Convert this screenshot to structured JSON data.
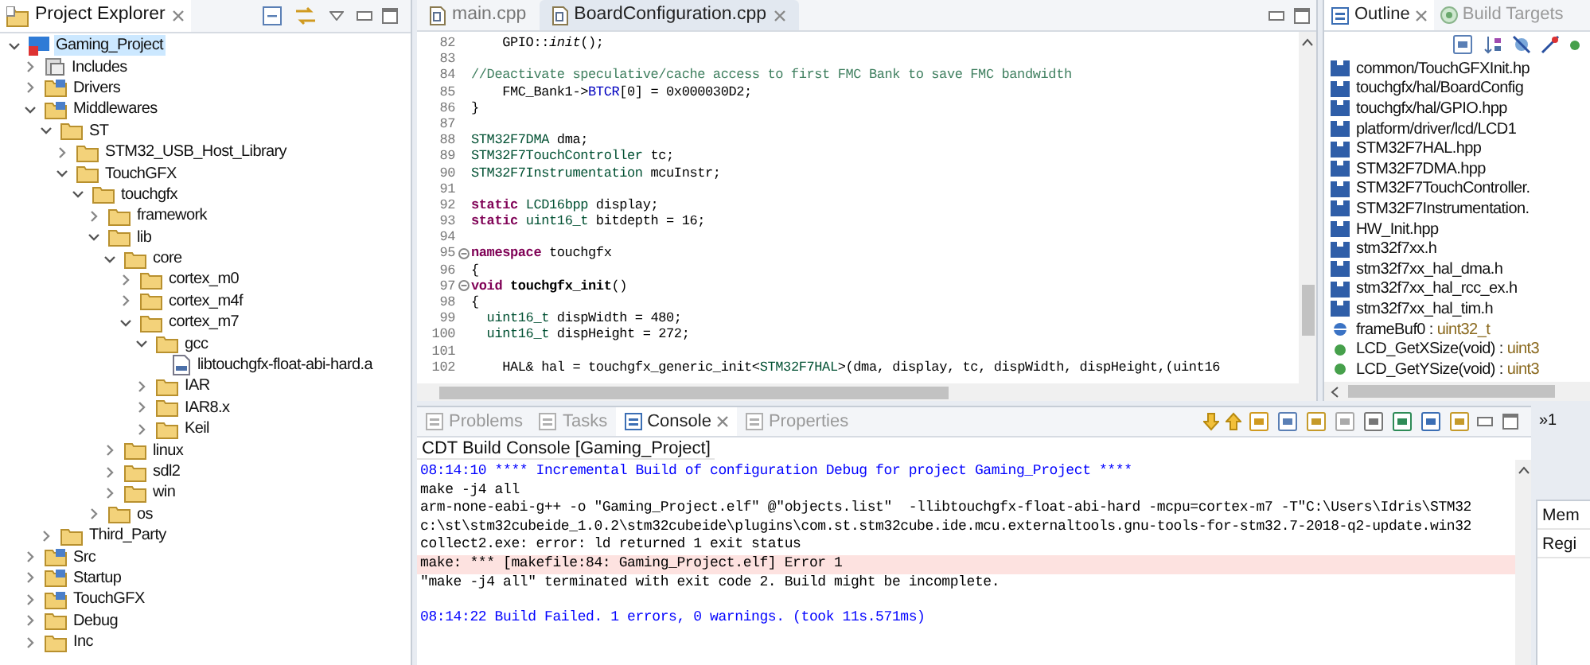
{
  "project_explorer": {
    "tab": {
      "label": "Project Explorer",
      "selected": true
    },
    "tree": [
      {
        "label": "Gaming_Project",
        "kind": "project",
        "expanded": true,
        "selected": true,
        "children": [
          {
            "label": "Includes",
            "kind": "includes",
            "expanded": false,
            "selected": false
          },
          {
            "label": "Drivers",
            "kind": "source_folder",
            "expanded": false,
            "selected": false
          },
          {
            "label": "Middlewares",
            "kind": "source_folder",
            "expanded": true,
            "selected": false,
            "children": [
              {
                "label": "ST",
                "kind": "folder",
                "expanded": true,
                "selected": false,
                "children": [
                  {
                    "label": "STM32_USB_Host_Library",
                    "kind": "folder",
                    "expanded": false,
                    "selected": false
                  },
                  {
                    "label": "TouchGFX",
                    "kind": "folder",
                    "expanded": true,
                    "selected": false,
                    "children": [
                      {
                        "label": "touchgfx",
                        "kind": "folder",
                        "expanded": true,
                        "selected": false,
                        "children": [
                          {
                            "label": "framework",
                            "kind": "folder",
                            "expanded": false,
                            "selected": false
                          },
                          {
                            "label": "lib",
                            "kind": "folder",
                            "expanded": true,
                            "selected": false,
                            "children": [
                              {
                                "label": "core",
                                "kind": "folder",
                                "expanded": true,
                                "selected": false,
                                "children": [
                                  {
                                    "label": "cortex_m0",
                                    "kind": "folder",
                                    "expanded": false,
                                    "selected": false
                                  },
                                  {
                                    "label": "cortex_m4f",
                                    "kind": "folder",
                                    "expanded": false,
                                    "selected": false
                                  },
                                  {
                                    "label": "cortex_m7",
                                    "kind": "folder",
                                    "expanded": true,
                                    "selected": false,
                                    "children": [
                                      {
                                        "label": "gcc",
                                        "kind": "folder",
                                        "expanded": true,
                                        "selected": false,
                                        "children": [
                                          {
                                            "label": "libtouchgfx-float-abi-hard.a",
                                            "kind": "file",
                                            "selected": false
                                          }
                                        ]
                                      },
                                      {
                                        "label": "IAR",
                                        "kind": "folder",
                                        "expanded": false,
                                        "selected": false
                                      },
                                      {
                                        "label": "IAR8.x",
                                        "kind": "folder",
                                        "expanded": false,
                                        "selected": false
                                      },
                                      {
                                        "label": "Keil",
                                        "kind": "folder",
                                        "expanded": false,
                                        "selected": false
                                      }
                                    ]
                                  }
                                ]
                              },
                              {
                                "label": "linux",
                                "kind": "folder",
                                "expanded": false,
                                "selected": false
                              },
                              {
                                "label": "sdl2",
                                "kind": "folder",
                                "expanded": false,
                                "selected": false
                              },
                              {
                                "label": "win",
                                "kind": "folder",
                                "expanded": false,
                                "selected": false
                              }
                            ]
                          },
                          {
                            "label": "os",
                            "kind": "folder",
                            "expanded": false,
                            "selected": false
                          }
                        ]
                      }
                    ]
                  }
                ]
              },
              {
                "label": "Third_Party",
                "kind": "folder",
                "expanded": false,
                "selected": false
              }
            ]
          },
          {
            "label": "Src",
            "kind": "source_folder",
            "expanded": false,
            "selected": false
          },
          {
            "label": "Startup",
            "kind": "source_folder",
            "expanded": false,
            "selected": false
          },
          {
            "label": "TouchGFX",
            "kind": "source_folder",
            "expanded": false,
            "selected": false
          },
          {
            "label": "Debug",
            "kind": "folder",
            "expanded": false,
            "selected": false
          },
          {
            "label": "Inc",
            "kind": "folder",
            "expanded": false,
            "selected": false
          }
        ]
      }
    ]
  },
  "editor": {
    "tabs": [
      {
        "label": "main.cpp",
        "selected": false
      },
      {
        "label": "BoardConfiguration.cpp",
        "selected": true
      }
    ],
    "lines": [
      {
        "number": "82",
        "tokens": [
          {
            "kind": "plain",
            "text": "    GPIO::"
          },
          {
            "kind": "static_call",
            "text": "init"
          },
          {
            "kind": "plain",
            "text": "();"
          }
        ]
      },
      {
        "number": "83"
      },
      {
        "number": "84",
        "tokens": [
          {
            "kind": "comment",
            "text": "//Deactivate speculative/cache access to first FMC Bank to save FMC bandwidth"
          }
        ]
      },
      {
        "number": "85",
        "tokens": [
          {
            "kind": "plain",
            "text": "    FMC_Bank1->"
          },
          {
            "kind": "field",
            "text": "BTCR"
          },
          {
            "kind": "plain",
            "text": "[0] = 0x000030D2;"
          }
        ]
      },
      {
        "number": "86",
        "tokens": [
          {
            "kind": "plain",
            "text": "}"
          }
        ]
      },
      {
        "number": "87"
      },
      {
        "number": "88",
        "tokens": [
          {
            "kind": "type",
            "text": "STM32F7DMA"
          },
          {
            "kind": "plain",
            "text": " dma;"
          }
        ]
      },
      {
        "number": "89",
        "tokens": [
          {
            "kind": "type",
            "text": "STM32F7TouchController"
          },
          {
            "kind": "plain",
            "text": " tc;"
          }
        ]
      },
      {
        "number": "90",
        "tokens": [
          {
            "kind": "type",
            "text": "STM32F7Instrumentation"
          },
          {
            "kind": "plain",
            "text": " mcuInstr;"
          }
        ]
      },
      {
        "number": "91"
      },
      {
        "number": "92",
        "tokens": [
          {
            "kind": "keyword",
            "text": "static "
          },
          {
            "kind": "type",
            "text": "LCD16bpp"
          },
          {
            "kind": "plain",
            "text": " display;"
          }
        ]
      },
      {
        "number": "93",
        "tokens": [
          {
            "kind": "keyword",
            "text": "static "
          },
          {
            "kind": "type",
            "text": "uint16_t"
          },
          {
            "kind": "plain",
            "text": " bitdepth = 16;"
          }
        ]
      },
      {
        "number": "94"
      },
      {
        "number": "95",
        "folding": true,
        "tokens": [
          {
            "kind": "keyword",
            "text": "namespace"
          },
          {
            "kind": "plain",
            "text": " touchgfx"
          }
        ]
      },
      {
        "number": "96",
        "tokens": [
          {
            "kind": "plain",
            "text": "{"
          }
        ]
      },
      {
        "number": "97",
        "folding": true,
        "tokens": [
          {
            "kind": "keyword",
            "text": "void "
          },
          {
            "kind": "function",
            "text": "touchgfx_init"
          },
          {
            "kind": "plain",
            "text": "()"
          }
        ]
      },
      {
        "number": "98",
        "tokens": [
          {
            "kind": "plain",
            "text": "{"
          }
        ]
      },
      {
        "number": "99",
        "tokens": [
          {
            "kind": "type",
            "text": "  uint16_t"
          },
          {
            "kind": "plain",
            "text": " dispWidth = 480;"
          }
        ]
      },
      {
        "number": "100",
        "tokens": [
          {
            "kind": "type",
            "text": "  uint16_t"
          },
          {
            "kind": "plain",
            "text": " dispHeight = 272;"
          }
        ]
      },
      {
        "number": "101"
      },
      {
        "number": "102",
        "tokens": [
          {
            "kind": "plain",
            "text": "    HAL& hal = touchgfx_generic_init<"
          },
          {
            "kind": "type",
            "text": "STM32F7HAL"
          },
          {
            "kind": "plain",
            "text": ">(dma, display, tc, dispWidth, dispHeight,(uint16"
          }
        ]
      }
    ]
  },
  "outline": {
    "tabs": [
      {
        "label": "Outline",
        "selected": true
      },
      {
        "label": "Build Targets",
        "selected": false
      }
    ],
    "items": [
      {
        "kind": "include",
        "label": "common/TouchGFXInit.hp"
      },
      {
        "kind": "include",
        "label": "touchgfx/hal/BoardConfig"
      },
      {
        "kind": "include",
        "label": "touchgfx/hal/GPIO.hpp"
      },
      {
        "kind": "include",
        "label": "platform/driver/lcd/LCD1"
      },
      {
        "kind": "include",
        "label": "STM32F7HAL.hpp"
      },
      {
        "kind": "include",
        "label": "STM32F7DMA.hpp"
      },
      {
        "kind": "include",
        "label": "STM32F7TouchController."
      },
      {
        "kind": "include",
        "label": "STM32F7Instrumentation."
      },
      {
        "kind": "include",
        "label": "HW_Init.hpp"
      },
      {
        "kind": "include",
        "label": "stm32f7xx.h"
      },
      {
        "kind": "include",
        "label": "stm32f7xx_hal_dma.h"
      },
      {
        "kind": "include",
        "label": "stm32f7xx_hal_rcc_ex.h"
      },
      {
        "kind": "include",
        "label": "stm32f7xx_hal_tim.h"
      },
      {
        "kind": "variable",
        "label": "frameBuf0 :",
        "type": "uint32_t"
      },
      {
        "kind": "function",
        "label": "LCD_GetXSize(void) :",
        "type": "uint3"
      },
      {
        "kind": "function",
        "label": "LCD_GetYSize(void) :",
        "type": "uint3"
      }
    ]
  },
  "console": {
    "tabs": [
      {
        "label": "Problems",
        "selected": false
      },
      {
        "label": "Tasks",
        "selected": false
      },
      {
        "label": "Console",
        "selected": true
      },
      {
        "label": "Properties",
        "selected": false
      }
    ],
    "title": "CDT Build Console [Gaming_Project]",
    "lines": [
      {
        "kind": "info",
        "text": "08:14:10 **** Incremental Build of configuration Debug for project Gaming_Project ****"
      },
      {
        "kind": "plain",
        "text": "make -j4 all"
      },
      {
        "kind": "plain",
        "text": "arm-none-eabi-g++ -o \"Gaming_Project.elf\" @\"objects.list\"  -llibtouchgfx-float-abi-hard -mcpu=cortex-m7 -T\"C:\\Users\\Idris\\STM32"
      },
      {
        "kind": "plain",
        "text": "c:\\st\\stm32cubeide_1.0.2\\stm32cubeide\\plugins\\com.st.stm32cube.ide.mcu.externaltools.gnu-tools-for-stm32.7-2018-q2-update.win32"
      },
      {
        "kind": "plain",
        "text": "collect2.exe: error: ld returned 1 exit status"
      },
      {
        "kind": "error",
        "text": "make: *** [makefile:84: Gaming_Project.elf] Error 1"
      },
      {
        "kind": "plain",
        "text": "\"make -j4 all\" terminated with exit code 2. Build might be incomplete."
      },
      {
        "kind": "summary",
        "text": "08:14:22 Build Failed. 1 errors, 0 warnings. (took 11s.571ms)"
      }
    ]
  },
  "side_panel": {
    "tab": "»1",
    "labels": [
      "Mem",
      "Regi"
    ]
  }
}
